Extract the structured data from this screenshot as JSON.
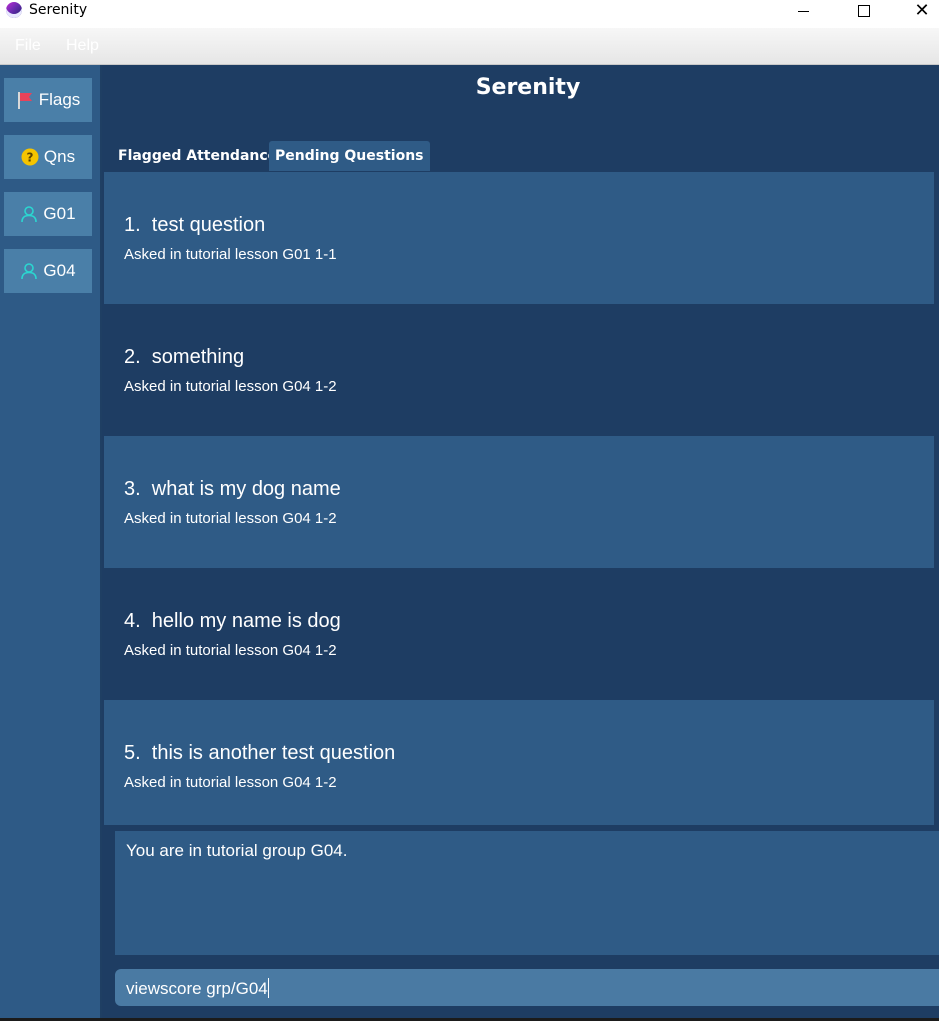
{
  "window": {
    "title": "Serenity"
  },
  "menu": {
    "file": "File",
    "help": "Help"
  },
  "sidebar": {
    "items": [
      {
        "label": "Flags",
        "icon": "flag-icon"
      },
      {
        "label": "Qns",
        "icon": "question-icon"
      },
      {
        "label": "G01",
        "icon": "person-icon"
      },
      {
        "label": "G04",
        "icon": "person-icon"
      }
    ]
  },
  "main": {
    "title": "Serenity",
    "tabs": [
      {
        "label": "Flagged Attendance",
        "selected": false
      },
      {
        "label": "Pending Questions",
        "selected": true
      }
    ],
    "questions": [
      {
        "title": "1.  test question",
        "subtitle": "Asked in tutorial lesson G01 1-1"
      },
      {
        "title": "2.  something",
        "subtitle": "Asked in tutorial lesson G04 1-2"
      },
      {
        "title": "3.  what is my dog name",
        "subtitle": "Asked in tutorial lesson G04 1-2"
      },
      {
        "title": "4.  hello my name is dog",
        "subtitle": "Asked in tutorial lesson G04 1-2"
      },
      {
        "title": "5.  this is another test question",
        "subtitle": "Asked in tutorial lesson G04 1-2"
      }
    ],
    "result": "You are in tutorial group G04.",
    "command": "viewscore grp/G04"
  },
  "colors": {
    "background_dark": "#1e3d63",
    "card_light": "#2f5b86",
    "sidebar_button": "#4a7fa8",
    "command_box": "#4a7aa3"
  }
}
